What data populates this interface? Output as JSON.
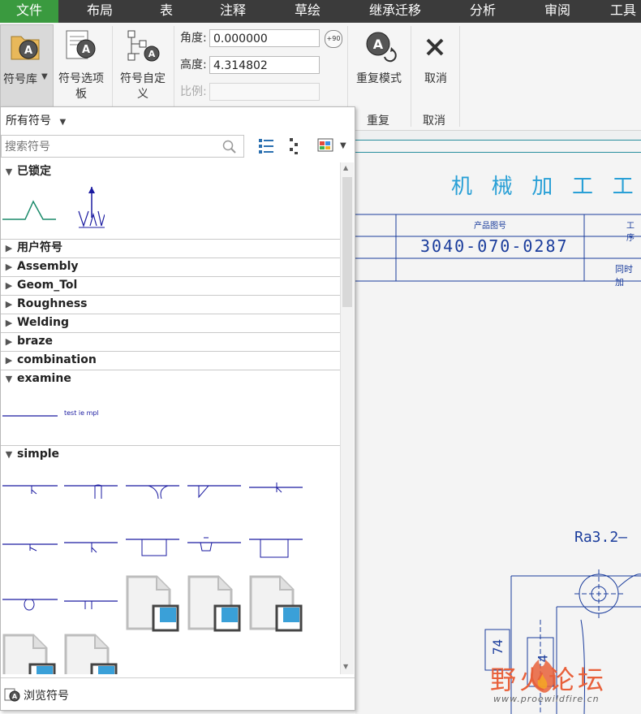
{
  "menu": {
    "items": [
      "文件",
      "布局",
      "表",
      "注释",
      "草绘",
      "继承迁移",
      "分析",
      "审阅",
      "工具"
    ],
    "active_color": "#3a9a3f"
  },
  "ribbon": {
    "symbol_library": "符号库",
    "symbol_palette_line1": "符号选项",
    "symbol_palette_line2": "板",
    "custom_symbol_line1": "符号自定",
    "custom_symbol_line2": "义",
    "angle_label": "角度:",
    "angle_value": "0.000000",
    "rotate_badge": "+90",
    "height_label": "高度:",
    "height_value": "4.314802",
    "scale_label": "比例:",
    "scale_value": "",
    "repeat_mode": "重复模式",
    "cancel": "取消",
    "group_repeat": "重复",
    "group_cancel": "取消"
  },
  "panel": {
    "filter": "所有符号",
    "search_placeholder": "搜索符号",
    "categories": [
      {
        "label": "已锁定",
        "expanded": true
      },
      {
        "label": "用户符号",
        "expanded": false
      },
      {
        "label": "Assembly",
        "expanded": false
      },
      {
        "label": "Geom_Tol",
        "expanded": false
      },
      {
        "label": "Roughness",
        "expanded": false
      },
      {
        "label": "Welding",
        "expanded": false
      },
      {
        "label": "braze",
        "expanded": false
      },
      {
        "label": "combination",
        "expanded": false
      },
      {
        "label": "examine",
        "expanded": true
      },
      {
        "label": "simple",
        "expanded": true
      }
    ],
    "examine_symbol_text": "test ie mpl",
    "browse": "浏览符号"
  },
  "drawing": {
    "title": "机 械 加 工 工",
    "product_label": "产品图号",
    "part_number": "3040-070-0287",
    "col3_label": "工序",
    "row2_label": "同时加",
    "roughness": "Ra3.2—",
    "dim_74": "74",
    "dim_4": "4",
    "line_color": "#1a3c9c",
    "title_color": "#2aa0d6"
  },
  "watermark": {
    "text": "野火论坛",
    "url": "www.proewildfire.cn"
  }
}
